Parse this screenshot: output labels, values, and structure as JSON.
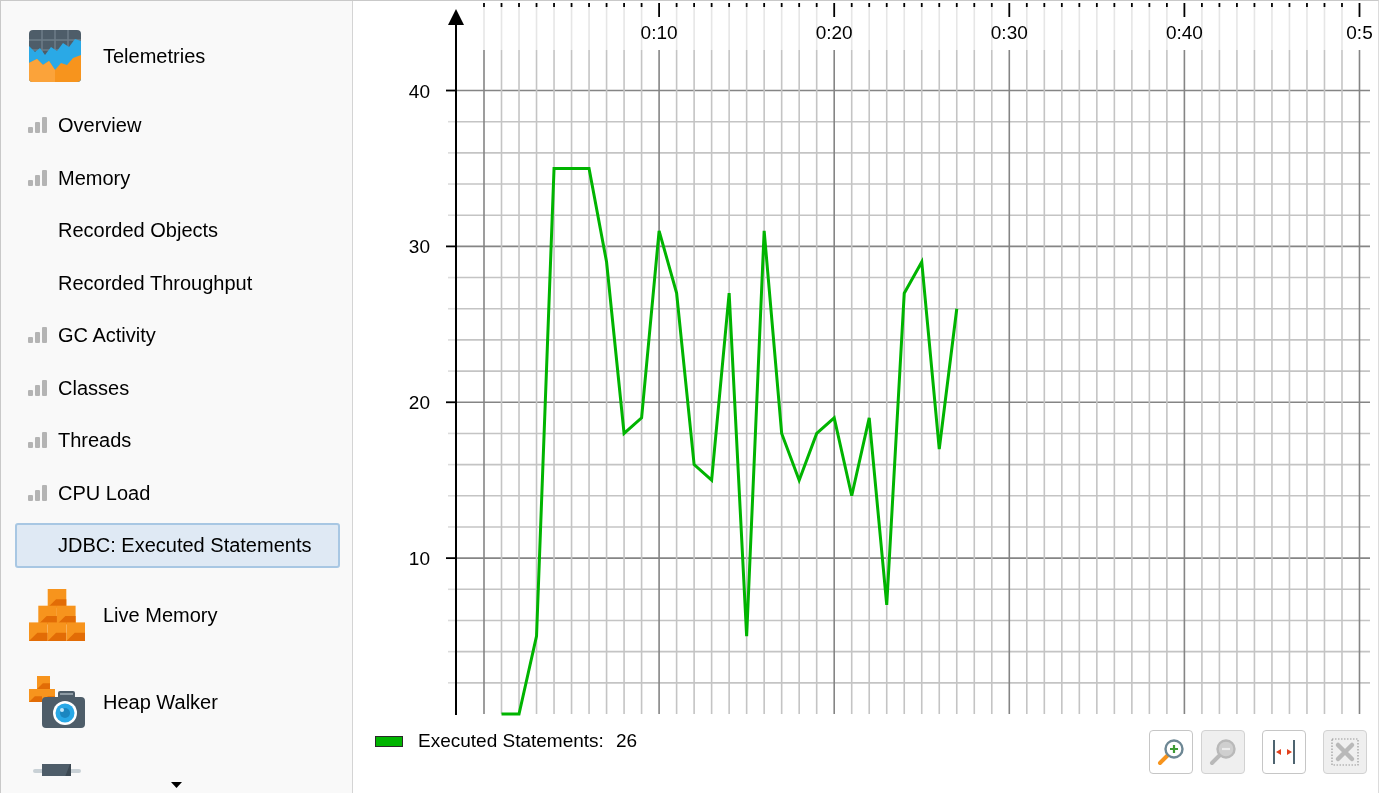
{
  "sidebar": {
    "items": [
      {
        "kind": "telemetries",
        "label": "Telemetries",
        "selected": false
      },
      {
        "kind": "metric",
        "label": "Overview",
        "selected": false
      },
      {
        "kind": "metric",
        "label": "Memory",
        "selected": false
      },
      {
        "kind": "plain",
        "label": "Recorded Objects",
        "selected": false
      },
      {
        "kind": "plain",
        "label": "Recorded Throughput",
        "selected": false
      },
      {
        "kind": "metric",
        "label": "GC Activity",
        "selected": false
      },
      {
        "kind": "metric",
        "label": "Classes",
        "selected": false
      },
      {
        "kind": "metric",
        "label": "Threads",
        "selected": false
      },
      {
        "kind": "metric",
        "label": "CPU Load",
        "selected": false
      },
      {
        "kind": "plain",
        "label": "JDBC: Executed Statements",
        "selected": true
      },
      {
        "kind": "memory",
        "label": "Live Memory",
        "selected": false
      },
      {
        "kind": "heap",
        "label": "Heap Walker",
        "selected": false
      },
      {
        "kind": "clipped",
        "selected": false
      }
    ],
    "more_below": true
  },
  "chart": {
    "chart_data": {
      "type": "line",
      "x": [
        1,
        2,
        3,
        4,
        5,
        6,
        7,
        8,
        9,
        10,
        11,
        12,
        13,
        14,
        15,
        16,
        17,
        18,
        19,
        20,
        21,
        22,
        23,
        24,
        25,
        26,
        27
      ],
      "values": [
        0,
        0,
        5,
        35,
        35,
        35,
        29,
        18,
        19,
        31,
        27,
        16,
        15,
        27,
        5,
        31,
        18,
        15,
        18,
        19,
        14,
        19,
        7,
        27,
        29,
        17,
        26
      ],
      "xlim": [
        0,
        50.6
      ],
      "ylim": [
        0,
        42.6
      ],
      "xticks": [
        {
          "value": 10,
          "label": "0:10"
        },
        {
          "value": 20,
          "label": "0:20"
        },
        {
          "value": 30,
          "label": "0:30"
        },
        {
          "value": 40,
          "label": "0:40"
        },
        {
          "value": 50,
          "label": "0:5"
        }
      ],
      "yticks": [
        10,
        20,
        30,
        40
      ],
      "grid": true
    },
    "legend": {
      "label": "Executed Statements:",
      "value": "26"
    }
  },
  "toolbar": {
    "buttons": [
      {
        "kind": "zoom-in",
        "disabled": false
      },
      {
        "kind": "zoom-out",
        "disabled": true
      },
      {
        "kind": "fit-width",
        "disabled": false
      },
      {
        "kind": "reset",
        "disabled": true
      }
    ]
  }
}
